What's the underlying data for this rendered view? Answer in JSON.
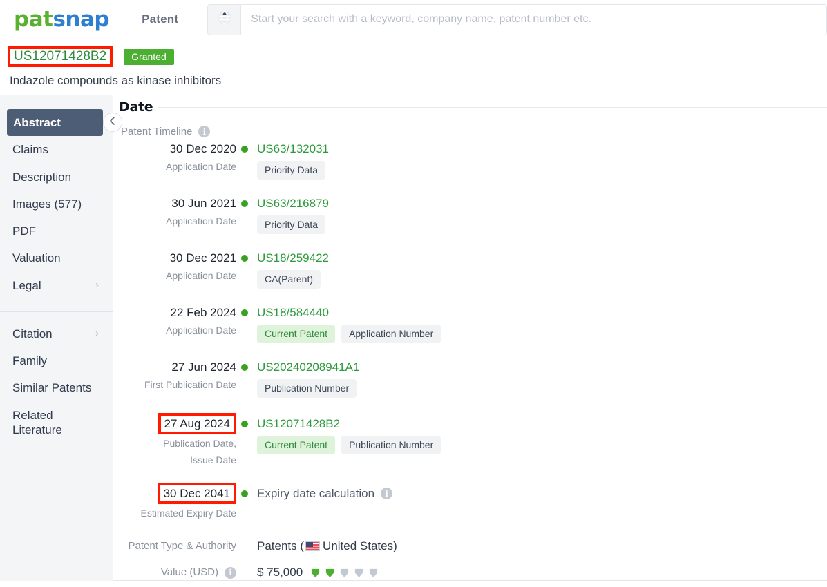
{
  "header": {
    "logo_pat": "pat",
    "logo_snap": "snap",
    "section": "Patent",
    "search_placeholder": "Start your search with a keyword, company name, patent number etc.",
    "search_value": "",
    "search_mode_icon": "globe-icon"
  },
  "patent": {
    "number": "US12071428B2",
    "status": "Granted",
    "title": "Indazole compounds as kinase inhibitors"
  },
  "sidebar": {
    "items": [
      {
        "label": "Abstract",
        "active": true,
        "chevron": false
      },
      {
        "label": "Claims",
        "active": false,
        "chevron": false
      },
      {
        "label": "Description",
        "active": false,
        "chevron": false
      },
      {
        "label": "Images (577)",
        "active": false,
        "chevron": false
      },
      {
        "label": "PDF",
        "active": false,
        "chevron": false
      },
      {
        "label": "Valuation",
        "active": false,
        "chevron": false
      },
      {
        "label": "Legal",
        "active": false,
        "chevron": true
      }
    ],
    "items2": [
      {
        "label": "Citation",
        "active": false,
        "chevron": true
      },
      {
        "label": "Family",
        "active": false,
        "chevron": false
      },
      {
        "label": "Similar Patents",
        "active": false,
        "chevron": false
      }
    ],
    "related_line1": "Related",
    "related_line2": "Literature",
    "collapse_icon": "chevron-left-icon"
  },
  "main": {
    "section_title": "Date",
    "timeline_label": "Patent Timeline",
    "timeline": [
      {
        "date": "30 Dec 2020",
        "sub": "Application Date",
        "number": "US63/132031",
        "is_link": true,
        "highlighted": false,
        "chips": [
          {
            "label": "Priority Data",
            "green": false
          }
        ]
      },
      {
        "date": "30 Jun 2021",
        "sub": "Application Date",
        "number": "US63/216879",
        "is_link": true,
        "highlighted": false,
        "chips": [
          {
            "label": "Priority Data",
            "green": false
          }
        ]
      },
      {
        "date": "30 Dec 2021",
        "sub": "Application Date",
        "number": "US18/259422",
        "is_link": true,
        "highlighted": false,
        "chips": [
          {
            "label": "CA(Parent)",
            "green": false
          }
        ]
      },
      {
        "date": "22 Feb 2024",
        "sub": "Application Date",
        "number": "US18/584440",
        "is_link": true,
        "highlighted": false,
        "chips": [
          {
            "label": "Current Patent",
            "green": true
          },
          {
            "label": "Application Number",
            "green": false
          }
        ]
      },
      {
        "date": "27 Jun 2024",
        "sub": "First Publication Date",
        "number": "US20240208941A1",
        "is_link": true,
        "highlighted": false,
        "chips": [
          {
            "label": "Publication Number",
            "green": false
          }
        ]
      },
      {
        "date": "27 Aug 2024",
        "sub": "Publication Date,",
        "sub2": "Issue Date",
        "number": "US12071428B2",
        "is_link": true,
        "highlighted": true,
        "chips": [
          {
            "label": "Current Patent",
            "green": true
          },
          {
            "label": "Publication Number",
            "green": false
          }
        ]
      },
      {
        "date": "30 Dec 2041",
        "sub": "Estimated Expiry Date",
        "number": "Expiry date calculation",
        "is_link": false,
        "has_info": true,
        "highlighted": true,
        "chips": []
      }
    ],
    "fields": [
      {
        "label": "Patent Type & Authority",
        "has_info": false,
        "value_prefix": "Patents (",
        "flag": "us-flag-icon",
        "value_suffix": " United States)",
        "type": "authority"
      },
      {
        "label": "Value (USD)",
        "has_info": true,
        "value": "$ 75,000",
        "rating": 2,
        "rating_max": 5,
        "type": "value"
      }
    ]
  },
  "colors": {
    "green_link": "#2c9a3c",
    "green_badge": "#4caf32",
    "green_dot": "#37a120",
    "annotation_red": "#ff1a00",
    "sidebar_active": "#4d5d75",
    "gem_on": "#4caf32",
    "gem_off": "#c3c9d2"
  }
}
